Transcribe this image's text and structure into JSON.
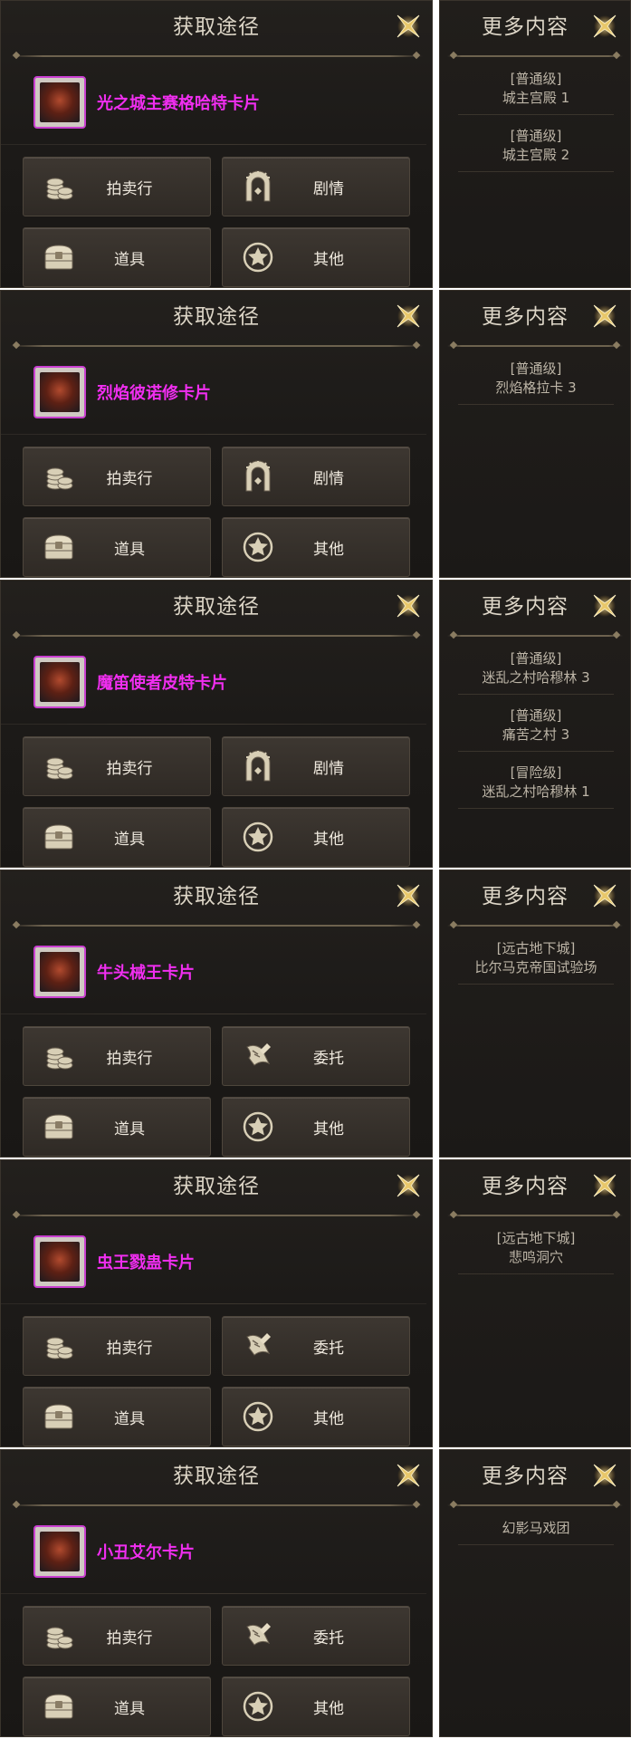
{
  "accent": "#f02ef0",
  "header_color": "#ddd6c7",
  "panels": [
    {
      "title": "获取途径",
      "more_title": "更多内容",
      "item_name": "光之城主赛格哈特卡片",
      "buttons": [
        {
          "label": "拍卖行",
          "icon": "coins-icon"
        },
        {
          "label": "剧情",
          "icon": "gate-icon"
        },
        {
          "label": "道具",
          "icon": "chest-icon"
        },
        {
          "label": "其他",
          "icon": "star-icon"
        }
      ],
      "entries": [
        {
          "level": "[普通级]",
          "place": "城主宫殿 1"
        },
        {
          "level": "[普通级]",
          "place": "城主宫殿 2"
        }
      ]
    },
    {
      "title": "获取途径",
      "more_title": "更多内容",
      "item_name": "烈焰彼诺修卡片",
      "buttons": [
        {
          "label": "拍卖行",
          "icon": "coins-icon"
        },
        {
          "label": "剧情",
          "icon": "gate-icon"
        },
        {
          "label": "道具",
          "icon": "chest-icon"
        },
        {
          "label": "其他",
          "icon": "star-icon"
        }
      ],
      "entries": [
        {
          "level": "[普通级]",
          "place": "烈焰格拉卡 3"
        }
      ]
    },
    {
      "title": "获取途径",
      "more_title": "更多内容",
      "item_name": "魔笛使者皮特卡片",
      "buttons": [
        {
          "label": "拍卖行",
          "icon": "coins-icon"
        },
        {
          "label": "剧情",
          "icon": "gate-icon"
        },
        {
          "label": "道具",
          "icon": "chest-icon"
        },
        {
          "label": "其他",
          "icon": "star-icon"
        }
      ],
      "entries": [
        {
          "level": "[普通级]",
          "place": "迷乱之村哈穆林 3"
        },
        {
          "level": "[普通级]",
          "place": "痛苦之村 3"
        },
        {
          "level": "[冒险级]",
          "place": "迷乱之村哈穆林 1"
        }
      ]
    },
    {
      "title": "获取途径",
      "more_title": "更多内容",
      "item_name": "牛头械王卡片",
      "buttons": [
        {
          "label": "拍卖行",
          "icon": "coins-icon"
        },
        {
          "label": "委托",
          "icon": "scroll-icon"
        },
        {
          "label": "道具",
          "icon": "chest-icon"
        },
        {
          "label": "其他",
          "icon": "star-icon"
        }
      ],
      "entries": [
        {
          "level": "[远古地下城]",
          "place": "比尔马克帝国试验场"
        }
      ]
    },
    {
      "title": "获取途径",
      "more_title": "更多内容",
      "item_name": "虫王戮蛊卡片",
      "buttons": [
        {
          "label": "拍卖行",
          "icon": "coins-icon"
        },
        {
          "label": "委托",
          "icon": "scroll-icon"
        },
        {
          "label": "道具",
          "icon": "chest-icon"
        },
        {
          "label": "其他",
          "icon": "star-icon"
        }
      ],
      "entries": [
        {
          "level": "[远古地下城]",
          "place": "悲鸣洞穴"
        }
      ]
    },
    {
      "title": "获取途径",
      "more_title": "更多内容",
      "item_name": "小丑艾尔卡片",
      "buttons": [
        {
          "label": "拍卖行",
          "icon": "coins-icon"
        },
        {
          "label": "委托",
          "icon": "scroll-icon"
        },
        {
          "label": "道具",
          "icon": "chest-icon"
        },
        {
          "label": "其他",
          "icon": "star-icon"
        }
      ],
      "entries": [
        {
          "level": "",
          "place": "幻影马戏团"
        }
      ]
    }
  ]
}
